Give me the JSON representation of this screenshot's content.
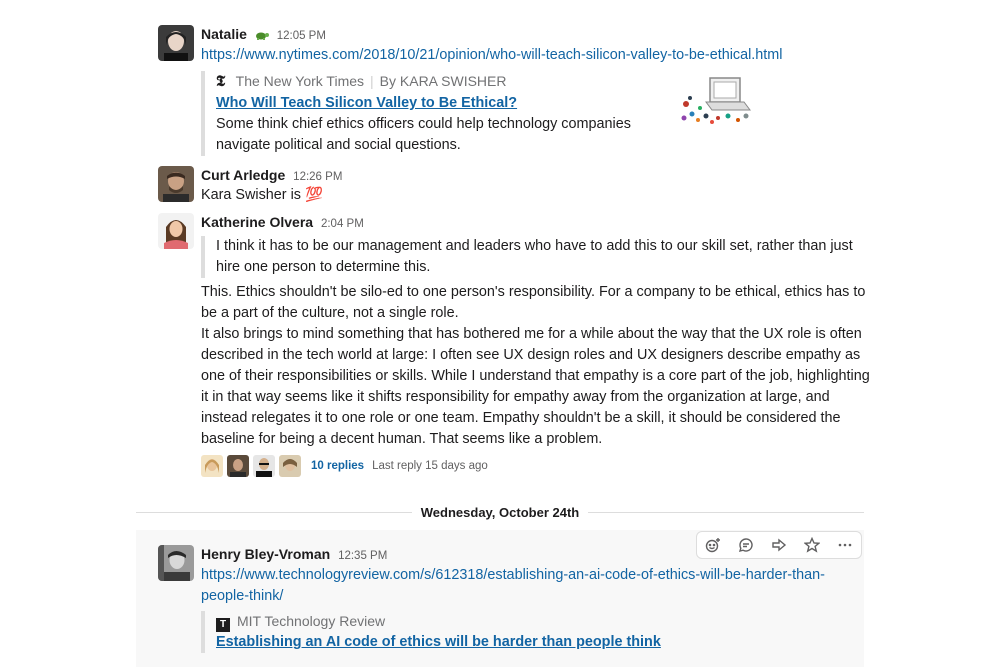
{
  "messages": [
    {
      "author": "Natalie",
      "time": "12:05 PM",
      "link": "https://www.nytimes.com/2018/10/21/opinion/who-will-teach-silicon-valley-to-be-ethical.html",
      "unfurl": {
        "source": "The New York Times",
        "byline": "By KARA SWISHER",
        "title": "Who Will Teach Silicon Valley to Be Ethical?",
        "desc_lines": [
          "Some think chief ethics officers could help technology companies",
          "navigate political and social questions."
        ]
      }
    },
    {
      "author": "Curt Arledge",
      "time": "12:26 PM",
      "text": "Kara Swisher is",
      "emoji": "💯"
    },
    {
      "author": "Katherine Olvera",
      "time": "2:04 PM",
      "quote_lines": [
        "I think it has to be our management and leaders who have to add this to our skill set, rather than just",
        "hire one person to determine this."
      ],
      "body_lines": [
        "This. Ethics shouldn't be silo-ed to one person's responsibility. For a company to be ethical, ethics has to",
        "be a part of the culture, not a single role.",
        "It also brings to mind something that has bothered me for a while about the way that the UX role is often",
        "described in the tech world at large: I often see UX design roles and UX designers describe empathy as",
        "one of their responsibilities or skills. While I understand that empathy is a core part of the job, highlighting",
        "it in that way seems like it shifts responsibility for empathy away from the organization at large, and",
        "instead relegates it to one role or one team. Empathy shouldn't be a skill, it should be considered the",
        "baseline for being a decent human. That seems like a problem."
      ],
      "replies": "10 replies",
      "last_reply": "Last reply 15 days ago"
    },
    {
      "author": "Henry Bley-Vroman",
      "time": "12:35 PM",
      "link_lines": [
        "https://www.technologyreview.com/s/612318/establishing-an-ai-code-of-ethics-will-be-harder-than-",
        "people-think/"
      ],
      "unfurl": {
        "source": "MIT Technology Review",
        "logo": "T",
        "title": "Establishing an AI code of ethics will be harder than people think"
      }
    }
  ],
  "date_divider": "Wednesday, October 24th",
  "hover_actions": [
    "add-reaction-icon",
    "reply-thread-icon",
    "share-icon",
    "star-icon",
    "more-icon"
  ],
  "colors": {
    "link": "#1264a3",
    "text": "#1d1c1d",
    "muted": "#616061"
  }
}
